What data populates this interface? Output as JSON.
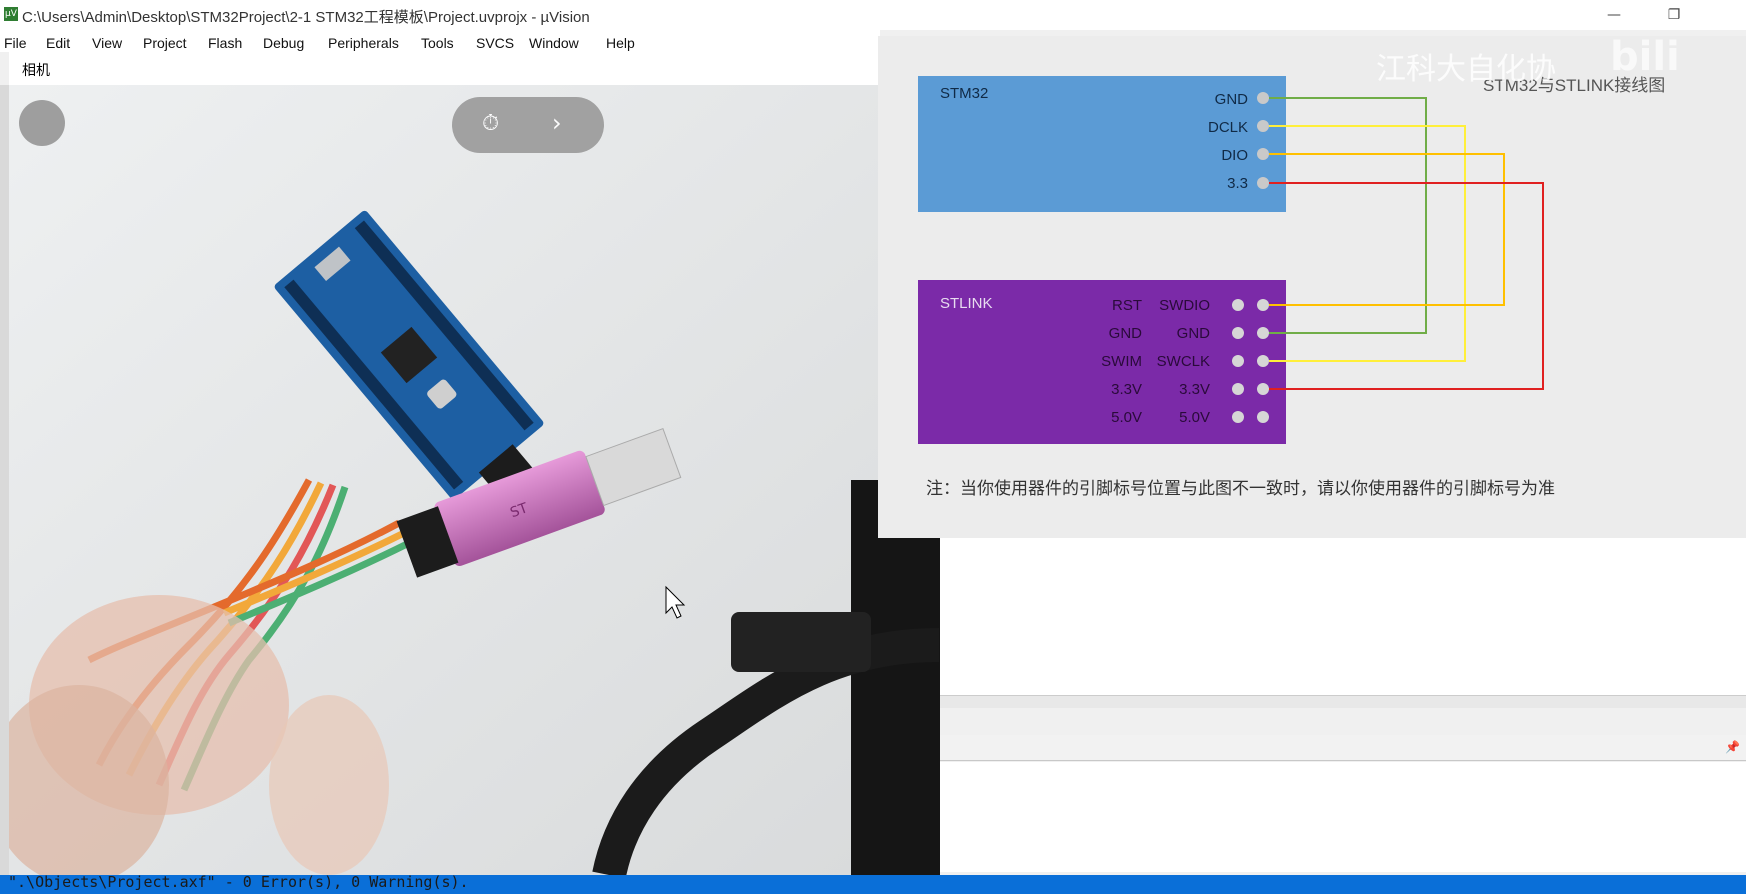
{
  "window": {
    "title": "C:\\Users\\Admin\\Desktop\\STM32Project\\2-1 STM32工程模板\\Project.uvprojx - µVision",
    "minimize": "—",
    "restore": "❐"
  },
  "menu": [
    "File",
    "Edit",
    "View",
    "Project",
    "Flash",
    "Debug",
    "Peripherals",
    "Tools",
    "SVCS",
    "Window",
    "Help"
  ],
  "camera": {
    "title": "相机"
  },
  "diagram": {
    "title": "STM32与STLINK接线图",
    "stm32_label": "STM32",
    "stm32_pins": [
      "GND",
      "DCLK",
      "DIO",
      "3.3"
    ],
    "stlink_label": "STLINK",
    "stlink_left_pins": [
      "RST",
      "GND",
      "SWIM",
      "3.3V",
      "5.0V"
    ],
    "stlink_right_pins": [
      "SWDIO",
      "GND",
      "SWCLK",
      "3.3V",
      "5.0V"
    ],
    "note": "注：当你使用器件的引脚标号位置与此图不一致时，请以你使用器件的引脚标号为准",
    "colors": {
      "stm32_box": "#5b9bd5",
      "stlink_box": "#7b2aa8",
      "wire_gnd": "#70ad47",
      "wire_clk": "#ffef3a",
      "wire_dio": "#ffc000",
      "wire_vcc": "#e02020"
    }
  },
  "watermark": "江科大自化协",
  "watermark_logo": "bili",
  "build_output": "\".\\Objects\\Project.axf\" - 0 Error(s), 0 Warning(s)."
}
